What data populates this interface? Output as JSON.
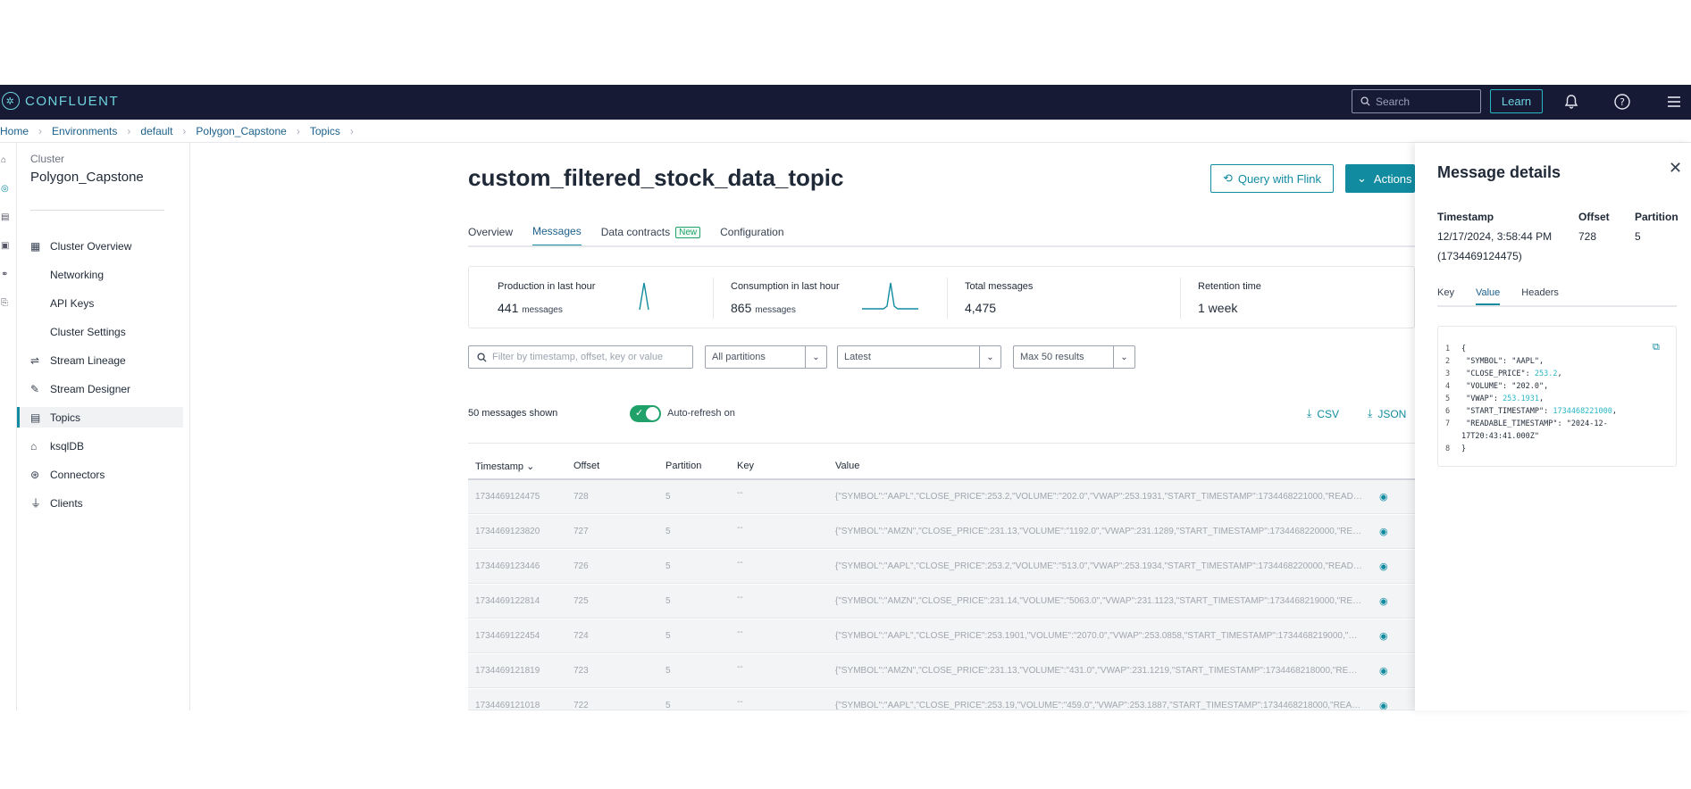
{
  "topbar": {
    "brand": "CONFLUENT",
    "search_placeholder": "Search",
    "learn_label": "Learn"
  },
  "breadcrumb": [
    "Home",
    "Environments",
    "default",
    "Polygon_Capstone",
    "Topics"
  ],
  "sidebar": {
    "cluster_label": "Cluster",
    "cluster_name": "Polygon_Capstone",
    "items": [
      {
        "label": "Cluster Overview"
      },
      {
        "label": "Networking"
      },
      {
        "label": "API Keys"
      },
      {
        "label": "Cluster Settings"
      },
      {
        "label": "Stream Lineage"
      },
      {
        "label": "Stream Designer"
      },
      {
        "label": "Topics"
      },
      {
        "label": "ksqlDB"
      },
      {
        "label": "Connectors"
      },
      {
        "label": "Clients"
      }
    ]
  },
  "main": {
    "title": "custom_filtered_stock_data_topic",
    "flink_button": "Query with Flink",
    "actions_button": "Actions",
    "tabs": [
      {
        "label": "Overview"
      },
      {
        "label": "Messages"
      },
      {
        "label": "Data contracts",
        "badge": "New"
      },
      {
        "label": "Configuration"
      }
    ],
    "stats": {
      "production_label": "Production in last hour",
      "production_value": "441",
      "production_unit": "messages",
      "consumption_label": "Consumption in last hour",
      "consumption_value": "865",
      "consumption_unit": "messages",
      "total_label": "Total messages",
      "total_value": "4,475",
      "retention_label": "Retention time",
      "retention_value": "1 week"
    },
    "filter": {
      "placeholder": "Filter by timestamp, offset, key or value",
      "partitions": "All partitions",
      "position": "Latest",
      "max_results": "Max 50 results"
    },
    "messages_shown": "50 messages shown",
    "auto_refresh": "Auto-refresh on",
    "csv_label": "CSV",
    "json_label": "JSON",
    "table": {
      "headers": [
        "Timestamp",
        "Offset",
        "Partition",
        "Key",
        "Value"
      ],
      "rows": [
        {
          "timestamp": "1734469124475",
          "offset": "728",
          "partition": "5",
          "key": "--",
          "value": "{\"SYMBOL\":\"AAPL\",\"CLOSE_PRICE\":253.2,\"VOLUME\":\"202.0\",\"VWAP\":253.1931,\"START_TIMESTAMP\":1734468221000,\"READAB..."
        },
        {
          "timestamp": "1734469123820",
          "offset": "727",
          "partition": "5",
          "key": "--",
          "value": "{\"SYMBOL\":\"AMZN\",\"CLOSE_PRICE\":231.13,\"VOLUME\":\"1192.0\",\"VWAP\":231.1289,\"START_TIMESTAMP\":1734468220000,\"READ..."
        },
        {
          "timestamp": "1734469123446",
          "offset": "726",
          "partition": "5",
          "key": "--",
          "value": "{\"SYMBOL\":\"AAPL\",\"CLOSE_PRICE\":253.2,\"VOLUME\":\"513.0\",\"VWAP\":253.1934,\"START_TIMESTAMP\":1734468220000,\"READA..."
        },
        {
          "timestamp": "1734469122814",
          "offset": "725",
          "partition": "5",
          "key": "--",
          "value": "{\"SYMBOL\":\"AMZN\",\"CLOSE_PRICE\":231.14,\"VOLUME\":\"5063.0\",\"VWAP\":231.1123,\"START_TIMESTAMP\":1734468219000,\"READ..."
        },
        {
          "timestamp": "1734469122454",
          "offset": "724",
          "partition": "5",
          "key": "--",
          "value": "{\"SYMBOL\":\"AAPL\",\"CLOSE_PRICE\":253.1901,\"VOLUME\":\"2070.0\",\"VWAP\":253.0858,\"START_TIMESTAMP\":1734468219000,\"RE..."
        },
        {
          "timestamp": "1734469121819",
          "offset": "723",
          "partition": "5",
          "key": "--",
          "value": "{\"SYMBOL\":\"AMZN\",\"CLOSE_PRICE\":231.13,\"VOLUME\":\"431.0\",\"VWAP\":231.1219,\"START_TIMESTAMP\":1734468218000,\"READA..."
        },
        {
          "timestamp": "1734469121018",
          "offset": "722",
          "partition": "5",
          "key": "--",
          "value": "{\"SYMBOL\":\"AAPL\",\"CLOSE_PRICE\":253.19,\"VOLUME\":\"459.0\",\"VWAP\":253.1887,\"START_TIMESTAMP\":1734468218000,\"READA..."
        }
      ]
    }
  },
  "details": {
    "title": "Message details",
    "timestamp_label": "Timestamp",
    "timestamp_value": "12/17/2024, 3:58:44 PM",
    "timestamp_epoch": "(1734469124475)",
    "offset_label": "Offset",
    "offset_value": "728",
    "partition_label": "Partition",
    "partition_value": "5",
    "tabs": [
      "Key",
      "Value",
      "Headers"
    ],
    "code_lines": [
      {
        "n": "1",
        "text": "{"
      },
      {
        "n": "2",
        "text": "  \"SYMBOL\": \"AAPL\","
      },
      {
        "n": "3",
        "key": "  \"CLOSE_PRICE\": ",
        "num": "253.2",
        "tail": ","
      },
      {
        "n": "4",
        "text": "  \"VOLUME\": \"202.0\","
      },
      {
        "n": "5",
        "key": "  \"VWAP\": ",
        "num": "253.1931",
        "tail": ","
      },
      {
        "n": "6",
        "key": "  \"START_TIMESTAMP\": ",
        "num": "1734468221000",
        "tail": ","
      },
      {
        "n": "7",
        "text": "  \"READABLE_TIMESTAMP\": \"2024-12-"
      },
      {
        "n": "",
        "text": "17T20:43:41.000Z\""
      },
      {
        "n": "8",
        "text": "}"
      }
    ]
  }
}
